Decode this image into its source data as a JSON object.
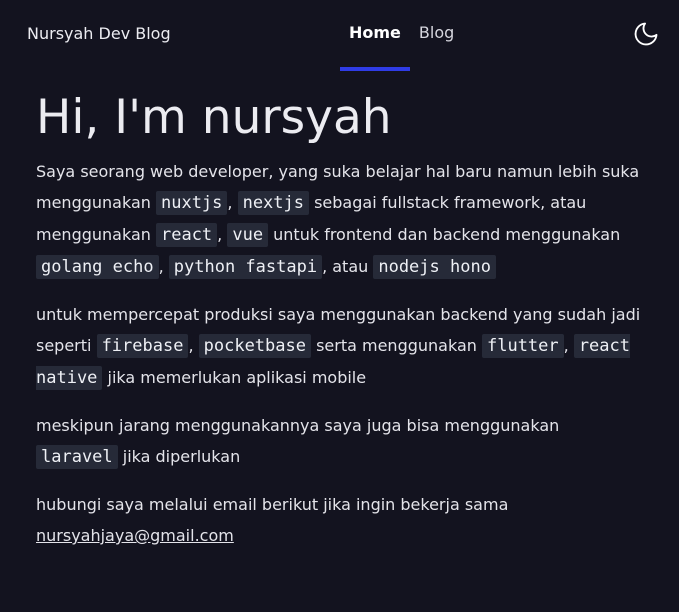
{
  "header": {
    "brand": "Nursyah Dev Blog",
    "nav": [
      {
        "label": "Home",
        "active": true
      },
      {
        "label": "Blog",
        "active": false
      }
    ],
    "theme_toggle_icon": "moon-icon"
  },
  "main": {
    "heading": "Hi, I'm nursyah",
    "p1": {
      "t1": "Saya seorang web developer, yang suka belajar hal baru namun lebih suka menggunakan ",
      "c1": "nuxtjs",
      "t2": ", ",
      "c2": "nextjs",
      "t3": " sebagai fullstack framework, atau menggunakan ",
      "c3": "react",
      "t4": ", ",
      "c4": "vue",
      "t5": " untuk frontend dan backend menggunakan ",
      "c5": "golang echo",
      "t6": ", ",
      "c6": "python fastapi",
      "t7": ", atau ",
      "c7": "nodejs hono"
    },
    "p2": {
      "t1": "untuk mempercepat produksi saya menggunakan backend yang sudah jadi seperti ",
      "c1": "firebase",
      "t2": ", ",
      "c2": "pocketbase",
      "t3": " serta menggunakan ",
      "c3": "flutter",
      "t4": ", ",
      "c4": "react native",
      "t5": " jika memerlukan aplikasi mobile"
    },
    "p3": {
      "t1": "meskipun jarang menggunakannya saya juga bisa menggunakan ",
      "c1": "laravel",
      "t2": " jika diperlukan"
    },
    "p4": {
      "t1": "hubungi saya melalui email berikut jika ingin bekerja sama",
      "email": "nursyahjaya@gmail.com"
    }
  },
  "colors": {
    "background": "#13131f",
    "accent": "#2f3ce6",
    "code_background": "#262a38"
  }
}
